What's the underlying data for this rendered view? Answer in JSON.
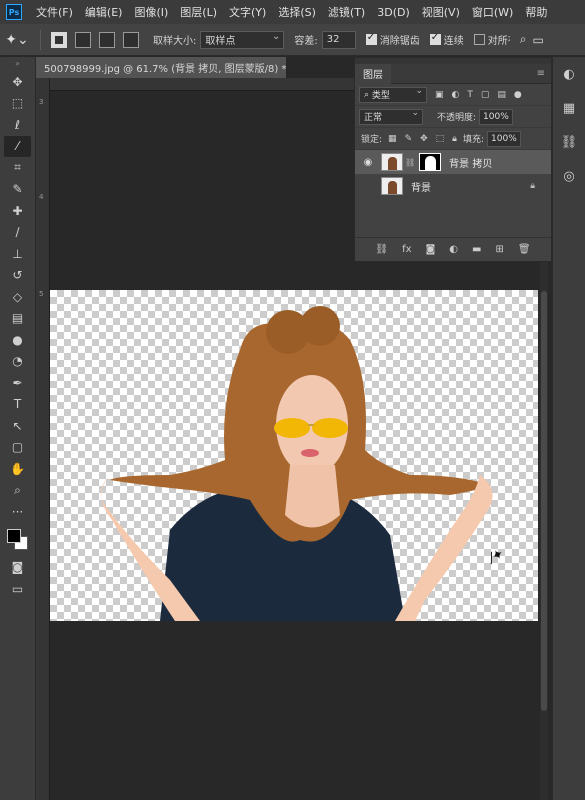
{
  "app": {
    "logo": "Ps"
  },
  "menu": [
    "文件(F)",
    "编辑(E)",
    "图像(I)",
    "图层(L)",
    "文字(Y)",
    "选择(S)",
    "滤镜(T)",
    "3D(D)",
    "视图(V)",
    "窗口(W)",
    "帮助"
  ],
  "options": {
    "sample_size_label": "取样大小:",
    "sample_size_value": "取样点",
    "tolerance_label": "容差:",
    "tolerance_value": "32",
    "antialias_label": "消除锯齿",
    "contiguous_label": "连续",
    "all_layers_label": "对所有图层取样"
  },
  "document": {
    "tab_title": "500798999.jpg @ 61.7% (背景 拷贝, 图层蒙版/8) *",
    "ruler_left_labels": [
      "3",
      "4",
      "5"
    ]
  },
  "layers_panel": {
    "tab": "图层",
    "filter_label": "类型",
    "blend_mode": "正常",
    "opacity_label": "不透明度:",
    "opacity_value": "100%",
    "lock_label": "锁定:",
    "fill_label": "填充:",
    "fill_value": "100%",
    "layers": [
      {
        "name": "背景 拷贝",
        "visible": true,
        "selected": true,
        "has_mask": true
      },
      {
        "name": "背景",
        "visible": false,
        "selected": false,
        "locked": true
      }
    ],
    "footer_icons": [
      "link-icon",
      "fx-icon",
      "mask-icon",
      "adjustment-icon",
      "folder-icon",
      "new-layer-icon",
      "trash-icon"
    ]
  },
  "tools": [
    "move-icon",
    "marquee-icon",
    "lasso-icon",
    "magic-wand-icon",
    "crop-icon",
    "eyedropper-icon",
    "healing-icon",
    "brush-icon",
    "stamp-icon",
    "history-brush-icon",
    "eraser-icon",
    "gradient-icon",
    "blur-icon",
    "dodge-icon",
    "pen-icon",
    "type-icon",
    "path-select-icon",
    "rectangle-icon",
    "hand-icon",
    "zoom-icon",
    "more-icon"
  ],
  "colors": {
    "foreground": "#000000",
    "background": "#ffffff",
    "accent": "#31a8ff"
  }
}
